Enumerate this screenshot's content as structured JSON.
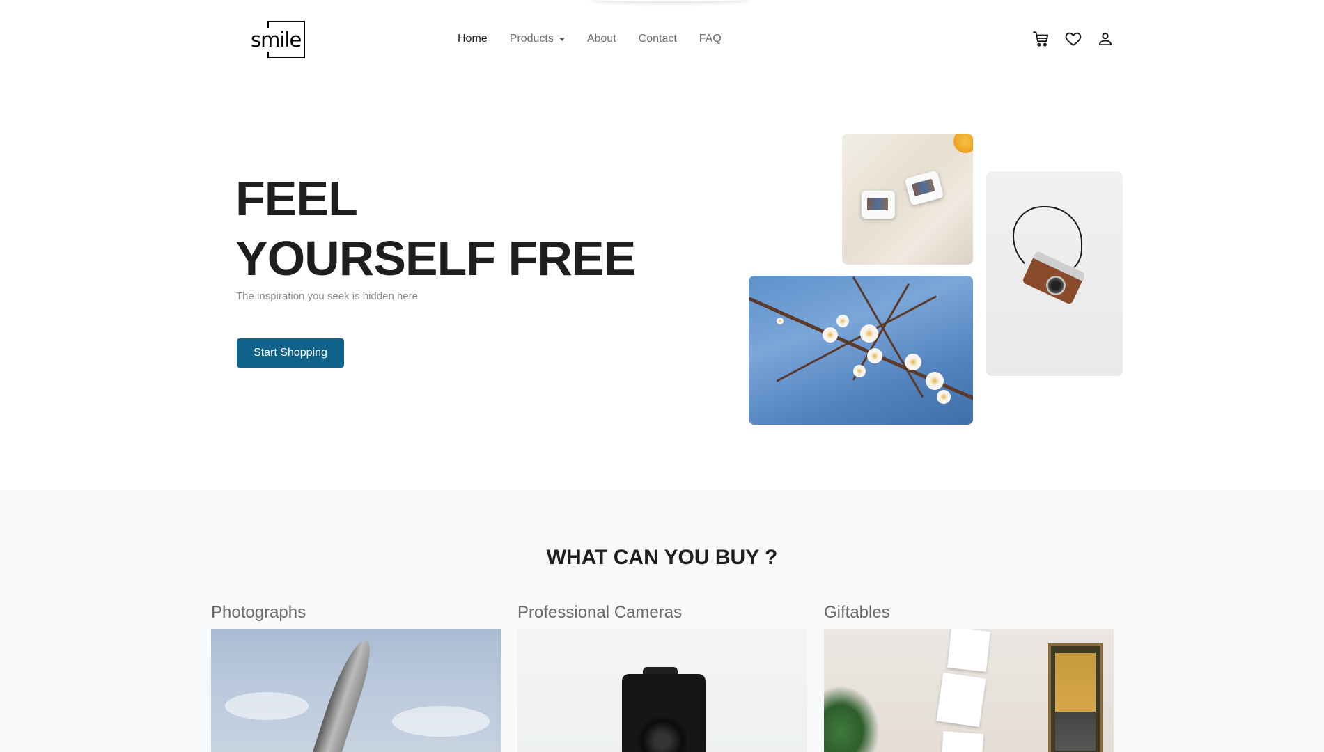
{
  "brand": {
    "logo_text": "smile"
  },
  "nav": {
    "links": [
      {
        "label": "Home",
        "active": true
      },
      {
        "label": "Products",
        "dropdown": true
      },
      {
        "label": "About"
      },
      {
        "label": "Contact"
      },
      {
        "label": "FAQ"
      }
    ],
    "icons": [
      "cart-icon",
      "heart-icon",
      "user-icon"
    ]
  },
  "hero": {
    "title_line1": "FEEL",
    "title_line2": "YOURSELF FREE",
    "subtitle": "The inspiration you seek is hidden here",
    "cta_label": "Start Shopping",
    "cta_color": "#0f6289"
  },
  "categories": {
    "heading": "WHAT CAN YOU BUY ?",
    "items": [
      {
        "title": "Photographs"
      },
      {
        "title": "Professional Cameras"
      },
      {
        "title": "Giftables"
      }
    ]
  }
}
